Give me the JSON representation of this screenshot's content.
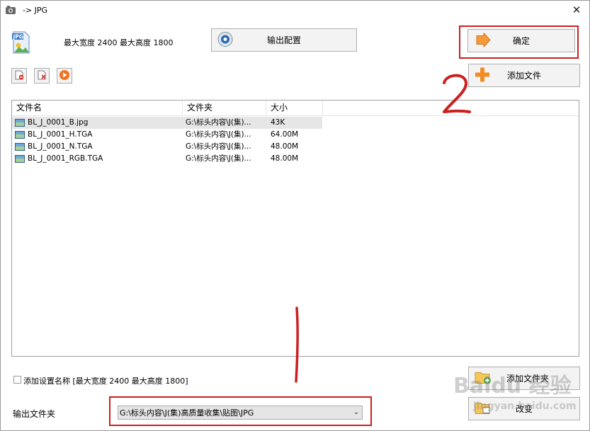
{
  "window": {
    "title": "-> JPG"
  },
  "info": {
    "limits": "最大宽度 2400  最大高度 1800"
  },
  "buttons": {
    "output_config": "输出配置",
    "ok": "确定",
    "add_file": "添加文件",
    "add_folder": "添加文件夹",
    "change": "改变"
  },
  "list": {
    "columns": [
      "文件名",
      "文件夹",
      "大小"
    ],
    "rows": [
      {
        "name": "BL_J_0001_B.jpg",
        "folder": "G:\\标头内容\\J(集)...",
        "size": "43K",
        "selected": true
      },
      {
        "name": "BL_J_0001_H.TGA",
        "folder": "G:\\标头内容\\J(集)...",
        "size": "64.00M",
        "selected": false
      },
      {
        "name": "BL_J_0001_N.TGA",
        "folder": "G:\\标头内容\\J(集)...",
        "size": "48.00M",
        "selected": false
      },
      {
        "name": "BL_J_0001_RGB.TGA",
        "folder": "G:\\标头内容\\J(集)...",
        "size": "48.00M",
        "selected": false
      }
    ]
  },
  "options": {
    "add_setting_name": "添加设置名称 [最大宽度 2400 最大高度 1800]"
  },
  "output": {
    "label": "输出文件夹",
    "path": "G:\\标头内容\\J(集)高质量收集\\贴图\\JPG"
  },
  "annotations": {
    "one": "1",
    "two": "2"
  },
  "watermark": {
    "line1": "Baidu 经验",
    "line2": "jingyan.baidu.com"
  },
  "colors": {
    "annotation_red": "#cc1f1f",
    "button_bg": "#f3f3f3",
    "selection": "#e6e6e6"
  }
}
